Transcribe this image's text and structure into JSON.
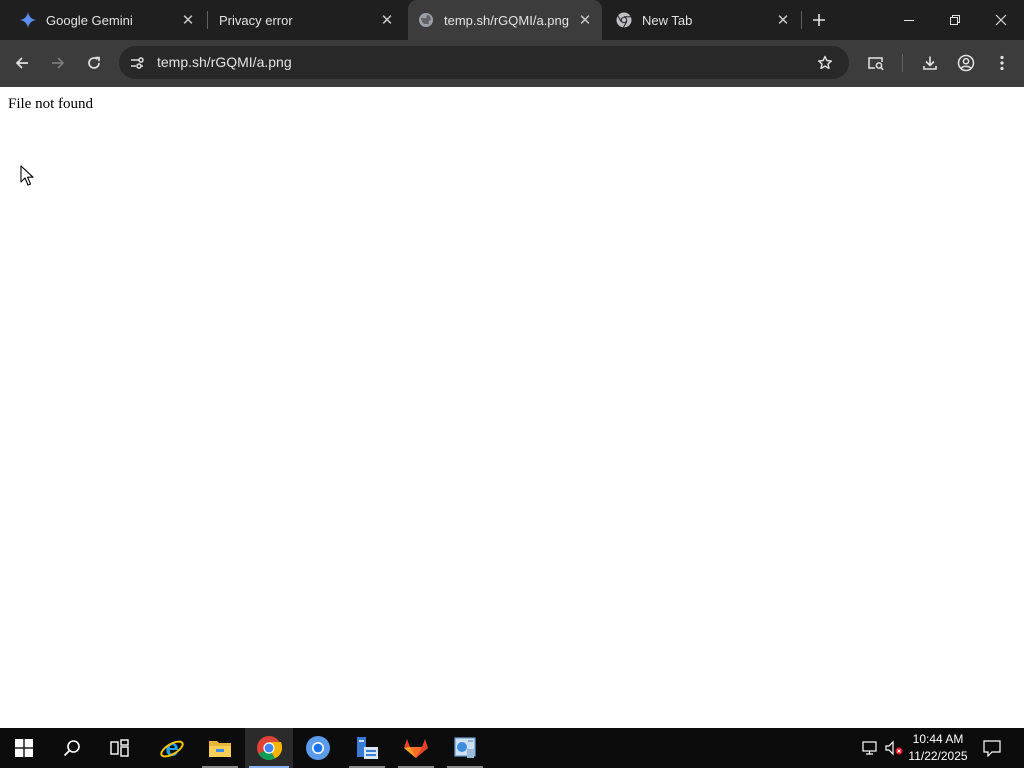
{
  "browser": {
    "tabs": [
      {
        "title": "Google Gemini",
        "icon": "gemini-icon"
      },
      {
        "title": "Privacy error",
        "icon": ""
      },
      {
        "title": "temp.sh/rGQMI/a.png",
        "icon": "globe-icon",
        "active": true
      },
      {
        "title": "New Tab",
        "icon": "chrome-icon"
      }
    ],
    "address_bar": {
      "url": "temp.sh/rGQMI/a.png"
    }
  },
  "page": {
    "message": "File not found"
  },
  "taskbar": {
    "apps": [
      "windows-start-icon",
      "search-icon",
      "task-view-icon",
      "internet-explorer-icon",
      "file-explorer-icon",
      "chrome-icon",
      "chrome-alt-icon",
      "server-manager-icon",
      "gitlab-icon",
      "control-panel-icon"
    ],
    "clock": {
      "time": "10:44 AM",
      "date": "11/22/2025"
    }
  },
  "colors": {
    "tabstrip": "#1f1f1f",
    "toolbar": "#3c3c3c",
    "omnibox": "#282828",
    "taskbar": "#0c0c0c"
  }
}
